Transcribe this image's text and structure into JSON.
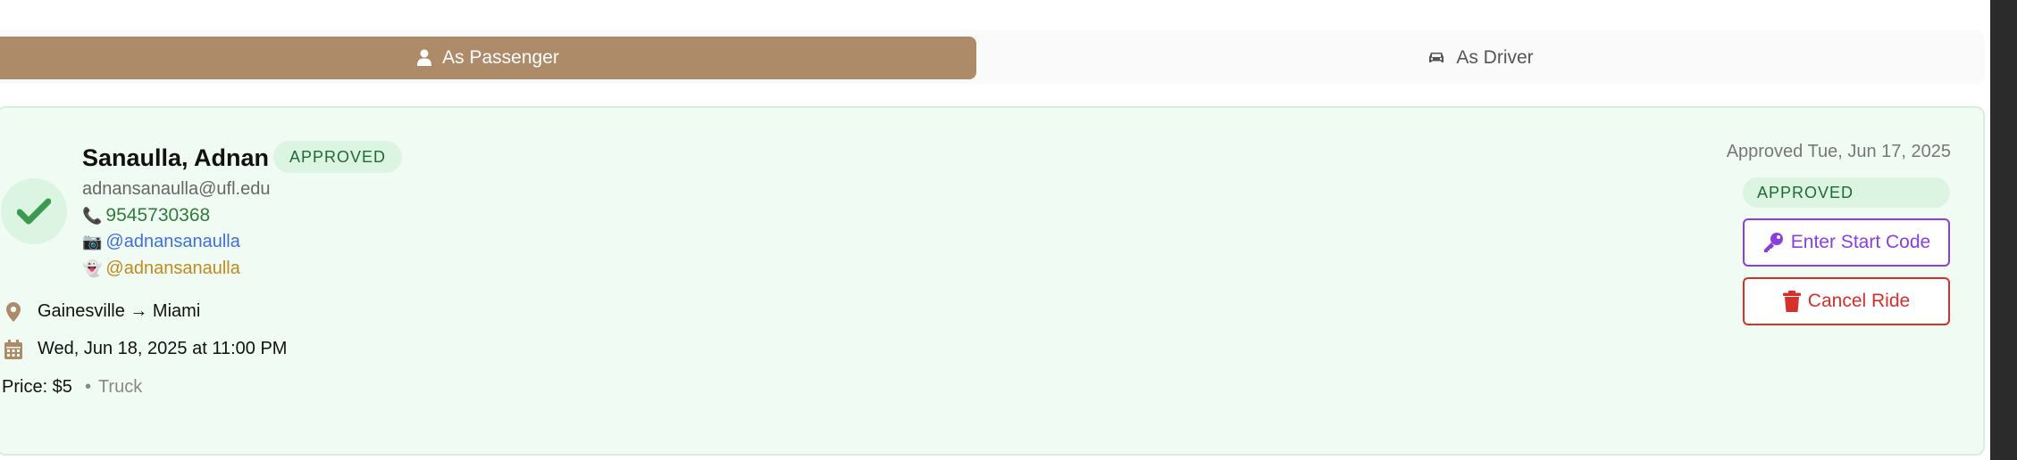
{
  "tabs": [
    {
      "label": "As Passenger",
      "icon": "user-icon",
      "active": true
    },
    {
      "label": "As Driver",
      "icon": "car-icon",
      "active": false
    }
  ],
  "colors": {
    "accent": "#ad8b68",
    "card_bg": "#f0fbf3",
    "approved_green": "#1f6b33",
    "start_purple": "#8a3ee0",
    "cancel_red": "#d6302a"
  },
  "ride": {
    "name": "Sanaulla, Adnan",
    "status_badge": "APPROVED",
    "email": "adnansanaulla@ufl.edu",
    "phone": "9545730368",
    "instagram": "@adnansanaulla",
    "snapchat": "@adnansanaulla",
    "route": "Gainesville → Miami",
    "datetime": "Wed, Jun 18, 2025 at 11:00 PM",
    "price_label": "Price: $5",
    "separator": "•",
    "vehicle": "Truck",
    "approved_date": "Approved Tue, Jun 17, 2025",
    "status_pill": "APPROVED",
    "actions": {
      "start_code": "Enter Start Code",
      "cancel": "Cancel Ride"
    }
  }
}
